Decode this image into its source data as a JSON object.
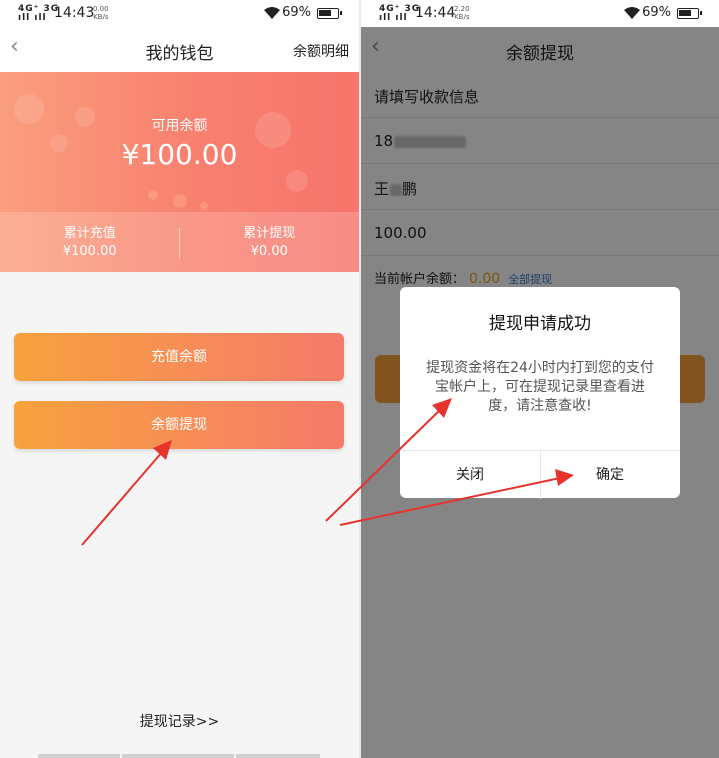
{
  "left": {
    "status": {
      "signal_top": "4G⁺ 3G",
      "signal_bottom": "ıll ıll",
      "time": "14:43",
      "speed_value": "0.00",
      "speed_unit": "KB/s",
      "battery_pct": "69%",
      "battery_level": 0.69
    },
    "nav": {
      "back_icon": "chevron-left-icon",
      "title": "我的钱包",
      "right_link": "余额明细"
    },
    "card": {
      "label": "可用余额",
      "amount": "¥100.00",
      "recharge_total_label": "累计充值",
      "recharge_total": "¥100.00",
      "withdraw_total_label": "累计提现",
      "withdraw_total": "¥0.00"
    },
    "buttons": {
      "recharge": "充值余额",
      "withdraw": "余额提现"
    },
    "history_link": "提现记录>>"
  },
  "right": {
    "status": {
      "signal_top": "4G⁺ 3G",
      "signal_bottom": "ıll ıll",
      "time": "14:44",
      "speed_value": "2.20",
      "speed_unit": "KB/s",
      "battery_pct": "69%",
      "battery_level": 0.69
    },
    "nav": {
      "back_icon": "chevron-left-icon",
      "title": "余额提现"
    },
    "form": {
      "heading": "请填写收款信息",
      "account_prefix": "18",
      "name_prefix": "王",
      "name_suffix": "鹏",
      "amount": "100.00",
      "balance_label": "当前帐户余额：",
      "balance_value": "0.00",
      "withdraw_all": "全部提现"
    },
    "dialog": {
      "title": "提现申请成功",
      "message": "提现资金将在24小时内打到您的支付宝帐户上，可在提现记录里查看进度，请注意查收!",
      "close": "关闭",
      "confirm": "确定"
    }
  },
  "colors": {
    "card_start": "#fa9e7d",
    "card_end": "#f6756c",
    "button_start": "#f7a23c",
    "button_end": "#f67a68",
    "arrow": "#e8322c",
    "link_blue": "#3a7bd5",
    "balance_orange": "#f0a020"
  }
}
